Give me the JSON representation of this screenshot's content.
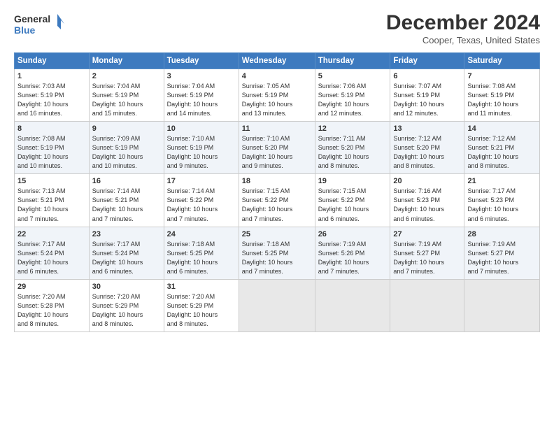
{
  "logo": {
    "line1": "General",
    "line2": "Blue"
  },
  "title": "December 2024",
  "location": "Cooper, Texas, United States",
  "headers": [
    "Sunday",
    "Monday",
    "Tuesday",
    "Wednesday",
    "Thursday",
    "Friday",
    "Saturday"
  ],
  "weeks": [
    [
      {
        "day": "1",
        "info": "Sunrise: 7:03 AM\nSunset: 5:19 PM\nDaylight: 10 hours\nand 16 minutes."
      },
      {
        "day": "2",
        "info": "Sunrise: 7:04 AM\nSunset: 5:19 PM\nDaylight: 10 hours\nand 15 minutes."
      },
      {
        "day": "3",
        "info": "Sunrise: 7:04 AM\nSunset: 5:19 PM\nDaylight: 10 hours\nand 14 minutes."
      },
      {
        "day": "4",
        "info": "Sunrise: 7:05 AM\nSunset: 5:19 PM\nDaylight: 10 hours\nand 13 minutes."
      },
      {
        "day": "5",
        "info": "Sunrise: 7:06 AM\nSunset: 5:19 PM\nDaylight: 10 hours\nand 12 minutes."
      },
      {
        "day": "6",
        "info": "Sunrise: 7:07 AM\nSunset: 5:19 PM\nDaylight: 10 hours\nand 12 minutes."
      },
      {
        "day": "7",
        "info": "Sunrise: 7:08 AM\nSunset: 5:19 PM\nDaylight: 10 hours\nand 11 minutes."
      }
    ],
    [
      {
        "day": "8",
        "info": "Sunrise: 7:08 AM\nSunset: 5:19 PM\nDaylight: 10 hours\nand 10 minutes."
      },
      {
        "day": "9",
        "info": "Sunrise: 7:09 AM\nSunset: 5:19 PM\nDaylight: 10 hours\nand 10 minutes."
      },
      {
        "day": "10",
        "info": "Sunrise: 7:10 AM\nSunset: 5:19 PM\nDaylight: 10 hours\nand 9 minutes."
      },
      {
        "day": "11",
        "info": "Sunrise: 7:10 AM\nSunset: 5:20 PM\nDaylight: 10 hours\nand 9 minutes."
      },
      {
        "day": "12",
        "info": "Sunrise: 7:11 AM\nSunset: 5:20 PM\nDaylight: 10 hours\nand 8 minutes."
      },
      {
        "day": "13",
        "info": "Sunrise: 7:12 AM\nSunset: 5:20 PM\nDaylight: 10 hours\nand 8 minutes."
      },
      {
        "day": "14",
        "info": "Sunrise: 7:12 AM\nSunset: 5:21 PM\nDaylight: 10 hours\nand 8 minutes."
      }
    ],
    [
      {
        "day": "15",
        "info": "Sunrise: 7:13 AM\nSunset: 5:21 PM\nDaylight: 10 hours\nand 7 minutes."
      },
      {
        "day": "16",
        "info": "Sunrise: 7:14 AM\nSunset: 5:21 PM\nDaylight: 10 hours\nand 7 minutes."
      },
      {
        "day": "17",
        "info": "Sunrise: 7:14 AM\nSunset: 5:22 PM\nDaylight: 10 hours\nand 7 minutes."
      },
      {
        "day": "18",
        "info": "Sunrise: 7:15 AM\nSunset: 5:22 PM\nDaylight: 10 hours\nand 7 minutes."
      },
      {
        "day": "19",
        "info": "Sunrise: 7:15 AM\nSunset: 5:22 PM\nDaylight: 10 hours\nand 6 minutes."
      },
      {
        "day": "20",
        "info": "Sunrise: 7:16 AM\nSunset: 5:23 PM\nDaylight: 10 hours\nand 6 minutes."
      },
      {
        "day": "21",
        "info": "Sunrise: 7:17 AM\nSunset: 5:23 PM\nDaylight: 10 hours\nand 6 minutes."
      }
    ],
    [
      {
        "day": "22",
        "info": "Sunrise: 7:17 AM\nSunset: 5:24 PM\nDaylight: 10 hours\nand 6 minutes."
      },
      {
        "day": "23",
        "info": "Sunrise: 7:17 AM\nSunset: 5:24 PM\nDaylight: 10 hours\nand 6 minutes."
      },
      {
        "day": "24",
        "info": "Sunrise: 7:18 AM\nSunset: 5:25 PM\nDaylight: 10 hours\nand 6 minutes."
      },
      {
        "day": "25",
        "info": "Sunrise: 7:18 AM\nSunset: 5:25 PM\nDaylight: 10 hours\nand 7 minutes."
      },
      {
        "day": "26",
        "info": "Sunrise: 7:19 AM\nSunset: 5:26 PM\nDaylight: 10 hours\nand 7 minutes."
      },
      {
        "day": "27",
        "info": "Sunrise: 7:19 AM\nSunset: 5:27 PM\nDaylight: 10 hours\nand 7 minutes."
      },
      {
        "day": "28",
        "info": "Sunrise: 7:19 AM\nSunset: 5:27 PM\nDaylight: 10 hours\nand 7 minutes."
      }
    ],
    [
      {
        "day": "29",
        "info": "Sunrise: 7:20 AM\nSunset: 5:28 PM\nDaylight: 10 hours\nand 8 minutes."
      },
      {
        "day": "30",
        "info": "Sunrise: 7:20 AM\nSunset: 5:29 PM\nDaylight: 10 hours\nand 8 minutes."
      },
      {
        "day": "31",
        "info": "Sunrise: 7:20 AM\nSunset: 5:29 PM\nDaylight: 10 hours\nand 8 minutes."
      },
      {
        "day": "",
        "info": ""
      },
      {
        "day": "",
        "info": ""
      },
      {
        "day": "",
        "info": ""
      },
      {
        "day": "",
        "info": ""
      }
    ]
  ]
}
